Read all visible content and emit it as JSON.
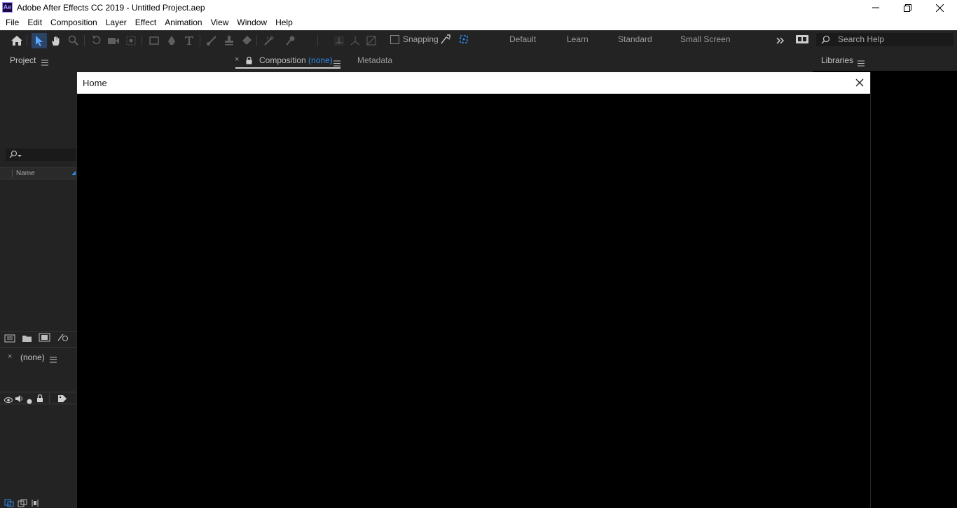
{
  "window": {
    "logo_text": "Ae",
    "title": "Adobe After Effects CC 2019 - Untitled Project.aep"
  },
  "menu": [
    "File",
    "Edit",
    "Composition",
    "Layer",
    "Effect",
    "Animation",
    "View",
    "Window",
    "Help"
  ],
  "toolbar": {
    "snapping_label": "Snapping",
    "workspaces": [
      "Default",
      "Learn",
      "Standard",
      "Small Screen"
    ],
    "search_placeholder": "Search Help"
  },
  "project_panel": {
    "tab_label": "Project",
    "column_name": "Name"
  },
  "timeline_panel": {
    "tab_label": "(none)"
  },
  "composition_panel": {
    "tab_prefix": "Composition",
    "tab_value": "(none)",
    "metadata_tab": "Metadata"
  },
  "libraries_panel": {
    "tab_label": "Libraries"
  },
  "home_dialog": {
    "title": "Home"
  },
  "colors": {
    "accent": "#2d8ceb",
    "panel_bg": "#232323",
    "modal_bg": "#000000"
  }
}
